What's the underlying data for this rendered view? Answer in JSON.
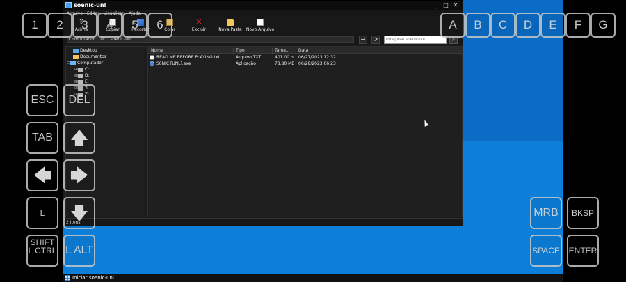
{
  "window": {
    "title": "soenic-unl",
    "controls": {
      "minimize": "_",
      "maximize": "□",
      "close": "✕"
    }
  },
  "menu": [
    "Arquivo",
    "Editar",
    "Visualizar",
    "Ajuda"
  ],
  "toolbar": {
    "buttons": [
      {
        "label": "Acima",
        "icon": "up-folder-icon"
      },
      {
        "label": "Copiar",
        "icon": "copy-icon"
      },
      {
        "label": "Recortar",
        "icon": "cut-icon"
      },
      {
        "label": "Colar",
        "icon": "paste-icon"
      },
      {
        "label": "Excluir",
        "icon": "delete-icon"
      },
      {
        "label": "Nova Pasta",
        "icon": "new-folder-icon"
      },
      {
        "label": "Novo Arquivo",
        "icon": "new-file-icon"
      }
    ]
  },
  "address": {
    "segments": [
      "Computador",
      "D:",
      "soenic-unl"
    ],
    "go_icon": "→",
    "refresh_icon": "⟳",
    "search_placeholder": "Pesquisar soenic-unl",
    "search_icon": "search-icon"
  },
  "tree": [
    {
      "label": "Desktop",
      "icon": "desktop-icon"
    },
    {
      "label": "Documentos",
      "icon": "documents-icon"
    },
    {
      "label": "Computador",
      "icon": "computer-icon"
    },
    {
      "label": "C:",
      "icon": "drive-icon"
    },
    {
      "label": "D:",
      "icon": "drive-icon"
    },
    {
      "label": "E:",
      "icon": "drive-icon"
    },
    {
      "label": "Y:",
      "icon": "drive-icon"
    },
    {
      "label": "Z:",
      "icon": "drive-icon"
    }
  ],
  "files": {
    "columns": [
      "Nome",
      "Tipo",
      "Tama...",
      "Data"
    ],
    "rows": [
      {
        "name": "READ ME BEFORE PLAYING.txt",
        "type": "Arquivo TXT",
        "size": "401.00 b...",
        "date": "06/27/2023 12:32",
        "icon": "text-file-icon"
      },
      {
        "name": "S0NIC [UNL].exe",
        "type": "Aplicação",
        "size": "78.80 MB",
        "date": "06/28/2023 06:23",
        "icon": "exe-file-icon"
      }
    ]
  },
  "status": "2 Itens",
  "taskbar": {
    "start": "Iniciar",
    "task": "soenic-unl"
  },
  "overlay": {
    "number_keys": [
      "1",
      "2",
      "3",
      "4",
      "5",
      "6"
    ],
    "letter_keys": [
      "A",
      "B",
      "C",
      "D",
      "E",
      "F",
      "G"
    ],
    "left_keys": {
      "esc": "ESC",
      "del": "DEL",
      "tab": "TAB",
      "lshift": "L SHIFT",
      "lctrl": "L CTRL",
      "lalt": "L ALT"
    },
    "right_keys": {
      "mrb": "MRB",
      "bksp": "BKSP",
      "space": "SPACE",
      "enter": "ENTER"
    }
  }
}
